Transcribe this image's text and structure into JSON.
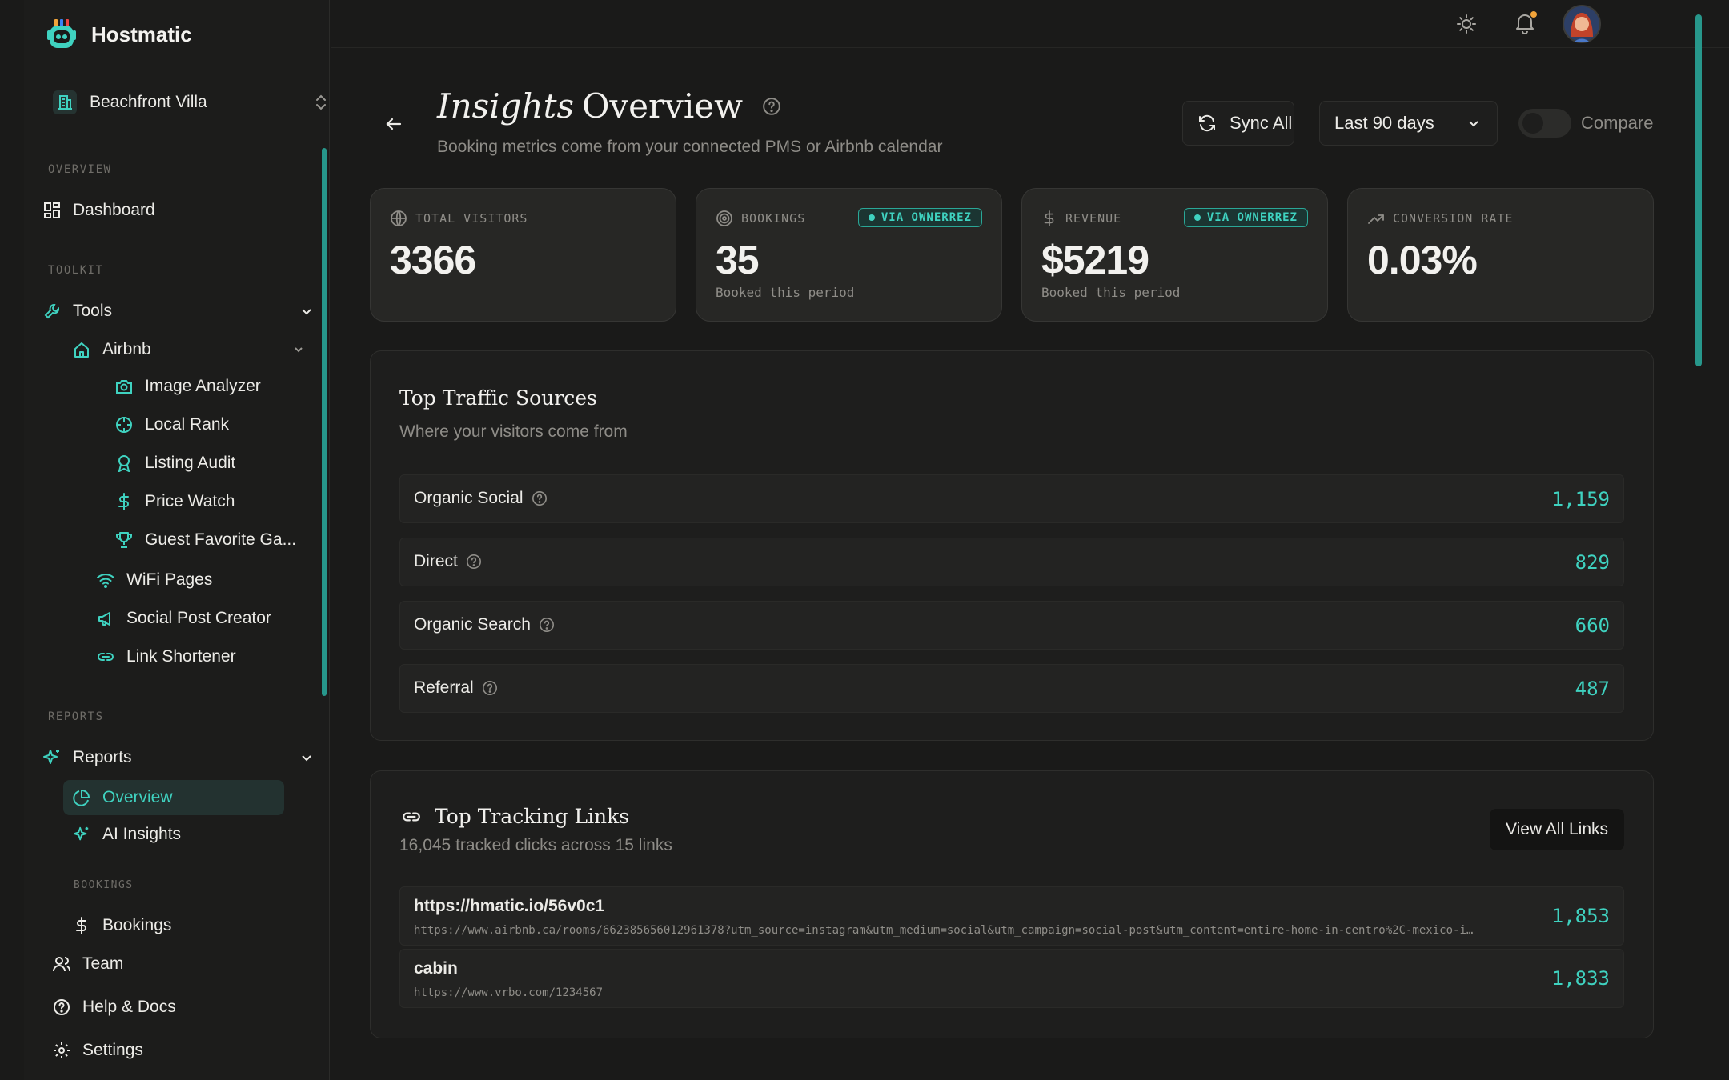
{
  "app": {
    "name": "Hostmatic"
  },
  "property": {
    "name": "Beachfront Villa"
  },
  "sidebar": {
    "sections": {
      "overview": "OVERVIEW",
      "toolkit": "TOOLKIT",
      "reports": "REPORTS",
      "bookings": "BOOKINGS"
    },
    "items": {
      "dashboard": "Dashboard",
      "tools": "Tools",
      "airbnb": "Airbnb",
      "image_analyzer": "Image Analyzer",
      "local_rank": "Local Rank",
      "listing_audit": "Listing Audit",
      "price_watch": "Price Watch",
      "guest_favorite": "Guest Favorite Ga...",
      "wifi_pages": "WiFi Pages",
      "social_post_creator": "Social Post Creator",
      "link_shortener": "Link Shortener",
      "reports": "Reports",
      "overview": "Overview",
      "ai_insights": "AI Insights",
      "bookings": "Bookings",
      "team": "Team",
      "help_docs": "Help & Docs",
      "settings": "Settings"
    }
  },
  "header": {
    "title_italic": "Insights",
    "title_rest": "Overview",
    "subtitle": "Booking metrics come from your connected PMS or Airbnb calendar",
    "sync_label": "Sync All",
    "range_label": "Last 90 days",
    "compare_label": "Compare"
  },
  "stats": [
    {
      "label": "TOTAL VISITORS",
      "value": "3366",
      "sub": "",
      "badge": ""
    },
    {
      "label": "BOOKINGS",
      "value": "35",
      "sub": "Booked this period",
      "badge": "VIA OWNERREZ"
    },
    {
      "label": "REVENUE",
      "value": "$5219",
      "sub": "Booked this period",
      "badge": "VIA OWNERREZ"
    },
    {
      "label": "CONVERSION RATE",
      "value": "0.03%",
      "sub": "",
      "badge": ""
    }
  ],
  "traffic": {
    "title": "Top Traffic Sources",
    "subtitle": "Where your visitors come from",
    "rows": [
      {
        "name": "Organic Social",
        "value": "1,159"
      },
      {
        "name": "Direct",
        "value": "829"
      },
      {
        "name": "Organic Search",
        "value": "660"
      },
      {
        "name": "Referral",
        "value": "487"
      }
    ]
  },
  "links": {
    "title": "Top Tracking Links",
    "subtitle": "16,045 tracked clicks across 15 links",
    "view_all": "View All Links",
    "rows": [
      {
        "short": "https://hmatic.io/56v0c1",
        "dest": "https://www.airbnb.ca/rooms/662385656012961378?utm_source=instagram&utm_medium=social&utm_campaign=social-post&utm_content=entire-home-in-centro%2C-mexico-i…",
        "value": "1,853"
      },
      {
        "short": "cabin",
        "dest": "https://www.vrbo.com/1234567",
        "value": "1,833"
      }
    ]
  },
  "colors": {
    "accent": "#3fd2c0",
    "background": "#1a1a19",
    "card": "#272725",
    "notification_dot": "#f2a43a"
  },
  "icons": [
    "logo-bot-icon",
    "building-icon",
    "chevrons-up-down-icon",
    "grid-icon",
    "wrench-icon",
    "home-icon",
    "camera-icon",
    "crosshair-icon",
    "award-icon",
    "dollar-icon",
    "trophy-icon",
    "wifi-icon",
    "megaphone-icon",
    "link-icon",
    "sparkles-icon",
    "pie-chart-icon",
    "users-icon",
    "help-circle-icon",
    "gear-icon",
    "sun-icon",
    "bell-icon",
    "refresh-icon",
    "arrow-left-icon",
    "globe-icon",
    "target-icon",
    "trending-up-icon"
  ]
}
